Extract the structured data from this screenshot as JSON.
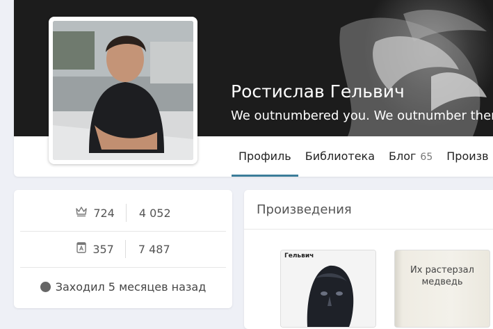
{
  "profile": {
    "name": "Ростислав Гельвич",
    "status": "We outnumbered you. We outnumber them a"
  },
  "tabs": [
    {
      "label": "Профиль",
      "active": true
    },
    {
      "label": "Библиотека"
    },
    {
      "label": "Блог",
      "count": "65"
    },
    {
      "label": "Произв"
    }
  ],
  "stats": {
    "row1": {
      "icon": "crown-icon",
      "left": "724",
      "right": "4 052"
    },
    "row2": {
      "icon": "book-icon",
      "left": "357",
      "right": "7 487"
    },
    "last_seen": "Заходил 5 месяцев назад"
  },
  "works": {
    "title": "Произведения",
    "books": [
      {
        "cover_label": "Гельвич"
      },
      {
        "title_line1": "Их растерзал",
        "title_line2": "медведь"
      }
    ]
  },
  "colors": {
    "accent": "#3b7d99",
    "background": "#eef0f6"
  }
}
